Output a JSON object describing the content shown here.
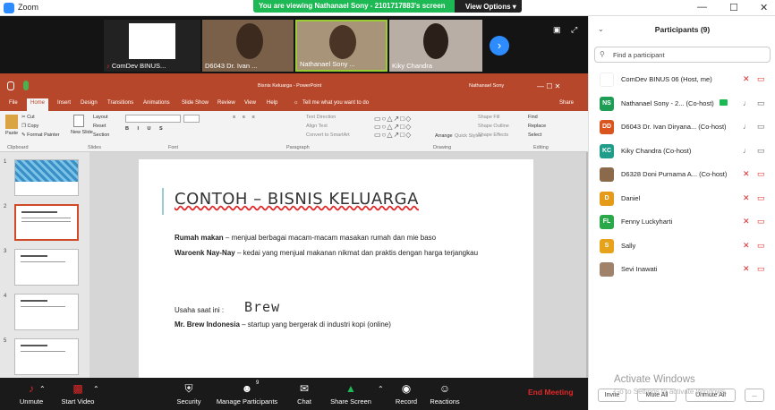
{
  "window": {
    "title": "Zoom"
  },
  "banner": {
    "text": "You are viewing Nathanael Sony - 2101717883's screen",
    "view_options": "View Options"
  },
  "gallery": {
    "tiles": [
      {
        "name": "ComDev BINUS..."
      },
      {
        "name": "D6043 Dr. Ivan ..."
      },
      {
        "name": "Nathanael Sony ..."
      },
      {
        "name": "Kiky Chandra"
      }
    ]
  },
  "ppt": {
    "doc_title": "Bisnis Keluarga  -  PowerPoint",
    "user": "Nathanael Sony",
    "tabs": [
      "File",
      "Home",
      "Insert",
      "Design",
      "Transitions",
      "Animations",
      "Slide Show",
      "Review",
      "View",
      "Help"
    ],
    "tell_me": "Tell me what you want to do",
    "share": "Share",
    "ribbon": {
      "paste": "Paste",
      "cut": "Cut",
      "copy": "Copy",
      "format_painter": "Format Painter",
      "new_slide": "New Slide",
      "layout": "Layout",
      "reset": "Reset",
      "section": "Section",
      "text_direction": "Text Direction",
      "align_text": "Align Text",
      "convert_smartart": "Convert to SmartArt",
      "arrange": "Arrange",
      "quick_styles": "Quick Styles",
      "shape_fill": "Shape Fill",
      "shape_outline": "Shape Outline",
      "shape_effects": "Shape Effects",
      "find": "Find",
      "replace": "Replace",
      "select": "Select",
      "groups": [
        "Clipboard",
        "Slides",
        "Font",
        "Paragraph",
        "Drawing",
        "Editing"
      ]
    },
    "slide_numbers": [
      "1",
      "2",
      "3",
      "4",
      "5"
    ],
    "slide": {
      "title": "CONTOH – BISNIS KELUARGA",
      "p1_bold": "Rumah makan",
      "p1_rest": " – menjual berbagai macam-macam masakan rumah dan mie baso",
      "p2_bold": "Waroenk Nay-Nay",
      "p2_rest": " – kedai yang menjual makanan nikmat dan praktis dengan harga terjangkau",
      "p3": "Usaha saat ini :",
      "logo_text": "Brew",
      "p4_bold": "Mr. Brew Indonesia",
      "p4_rest": " – startup yang bergerak di industri kopi (online)"
    }
  },
  "controls": {
    "unmute": "Unmute",
    "start_video": "Start Video",
    "security": "Security",
    "manage_participants": "Manage Participants",
    "participant_count": "9",
    "chat": "Chat",
    "share_screen": "Share Screen",
    "record": "Record",
    "reactions": "Reactions",
    "end_meeting": "End Meeting"
  },
  "panel": {
    "title": "Participants (9)",
    "search_placeholder": "Find a participant",
    "participants": [
      {
        "initials": "",
        "name": "ComDev BINUS 06 (Host, me)",
        "color": "#ffffff",
        "muted": true,
        "video": false
      },
      {
        "initials": "NS",
        "name": "Nathanael Sony - 2... (Co-host)",
        "color": "#1f9d55",
        "muted": false,
        "video": true
      },
      {
        "initials": "DD",
        "name": "D6043 Dr. Ivan Diryana... (Co-host)",
        "color": "#d9541e",
        "muted": false,
        "video": true
      },
      {
        "initials": "KC",
        "name": "Kiky Chandra (Co-host)",
        "color": "#1f9d8a",
        "muted": false,
        "video": true
      },
      {
        "initials": "",
        "name": "D6328 Doni Purnama A... (Co-host)",
        "color": "#8a6a4a",
        "muted": true,
        "video": false
      },
      {
        "initials": "D",
        "name": "Daniel",
        "color": "#e69a1a",
        "muted": true,
        "video": false
      },
      {
        "initials": "FL",
        "name": "Fenny Luckyharti",
        "color": "#2aa84a",
        "muted": true,
        "video": false
      },
      {
        "initials": "S",
        "name": "Sally",
        "color": "#e6a21a",
        "muted": true,
        "video": false
      },
      {
        "initials": "",
        "name": "Sevi Inawati",
        "color": "#a0826a",
        "muted": true,
        "video": false
      }
    ],
    "invite": "Invite",
    "mute_all": "Mute All",
    "unmute_all": "Unmute All",
    "more": "..."
  },
  "watermark": {
    "line1": "Activate Windows",
    "line2": "Go to Settings to activate Windows."
  },
  "colors": {
    "zoom_blue": "#2d8cff",
    "ppt_red": "#b7472a",
    "end_red": "#e02828",
    "banner_green": "#1db954"
  }
}
